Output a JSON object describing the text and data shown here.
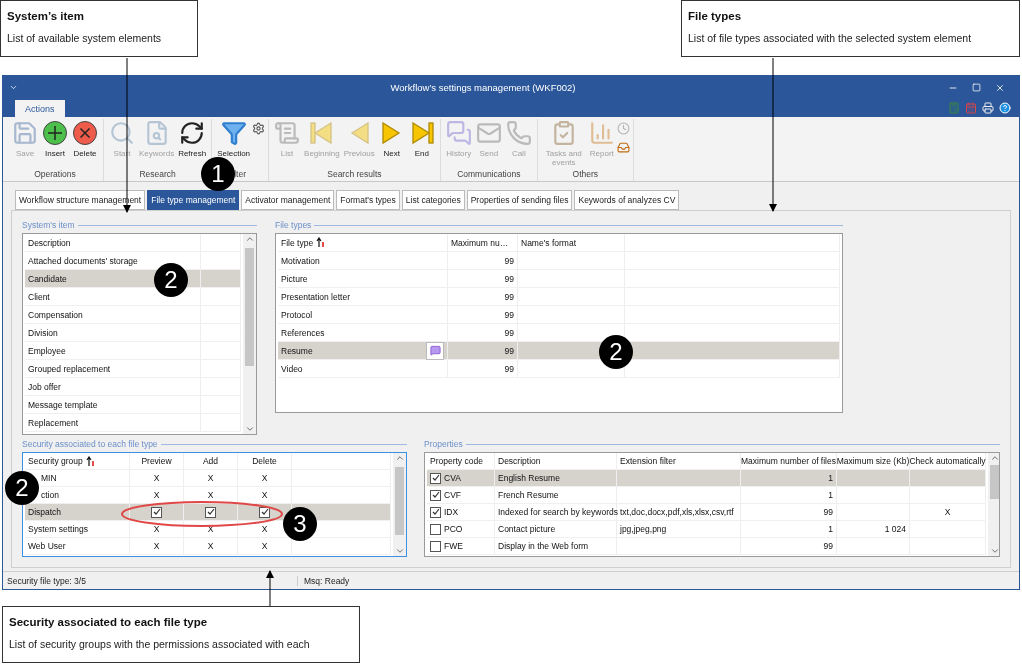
{
  "callouts": [
    {
      "title": "System’s item",
      "text": "List of available system elements"
    },
    {
      "title": "File types",
      "text": "List of file types associated with the selected system element"
    },
    {
      "title": "Security associated to each file type",
      "text": "List of security groups with the permissions associated with each"
    }
  ],
  "markers": [
    "1",
    "2",
    "2",
    "2",
    "3"
  ],
  "window": {
    "title": "Workflow’s settings management (WKF002)"
  },
  "ribbon_tabs": [
    {
      "label": "Actions",
      "selected": true
    }
  ],
  "ribbon_groups": [
    {
      "label": "Operations",
      "buttons": [
        {
          "kind": "save",
          "label": "Save",
          "disabled": true
        },
        {
          "kind": "insert",
          "label": "Insert",
          "disabled": false
        },
        {
          "kind": "delete",
          "label": "Delete",
          "disabled": false
        }
      ]
    },
    {
      "label": "Research",
      "buttons": [
        {
          "kind": "start",
          "label": "Start",
          "disabled": true
        },
        {
          "kind": "keywords",
          "label": "Keywords",
          "disabled": true
        },
        {
          "kind": "refresh",
          "label": "Refresh",
          "disabled": false
        }
      ]
    },
    {
      "label": "lter",
      "buttons": [
        {
          "kind": "selection",
          "label": "Selection",
          "disabled": false
        },
        {
          "kind": "settings",
          "disabled": false
        }
      ]
    },
    {
      "label": "Search results",
      "buttons": [
        {
          "kind": "list",
          "label": "List",
          "disabled": true
        },
        {
          "kind": "beginning",
          "label": "Beginning",
          "disabled": true
        },
        {
          "kind": "previous",
          "label": "Previous",
          "disabled": true
        },
        {
          "kind": "next",
          "label": "Next",
          "disabled": false
        },
        {
          "kind": "end",
          "label": "End",
          "disabled": false
        }
      ]
    },
    {
      "label": "Communications",
      "buttons": [
        {
          "kind": "history",
          "label": "History",
          "disabled": true
        },
        {
          "kind": "send",
          "label": "Send",
          "disabled": true
        },
        {
          "kind": "call",
          "label": "Call",
          "disabled": true
        }
      ]
    },
    {
      "label": "Others",
      "buttons": [
        {
          "kind": "tasks",
          "label": "Tasks and events",
          "disabled": true
        },
        {
          "kind": "report",
          "label": "Report",
          "disabled": true
        },
        {
          "kind": "clock",
          "disabled": true
        },
        {
          "kind": "inbox",
          "disabled": false
        }
      ]
    }
  ],
  "tabs": [
    {
      "label": "Workflow structure management",
      "selected": false
    },
    {
      "label": "File type management",
      "selected": true
    },
    {
      "label": "Activator management",
      "selected": false
    },
    {
      "label": "Format's types",
      "selected": false
    },
    {
      "label": "List categories",
      "selected": false
    },
    {
      "label": "Properties of sending files",
      "selected": false
    },
    {
      "label": "Keywords of analyzes CV",
      "selected": false
    }
  ],
  "system_items": {
    "title": "System's item",
    "columns": [
      "Description"
    ],
    "rows": [
      {
        "label": "Attached documents' storage",
        "selected": false
      },
      {
        "label": "Candidate",
        "selected": true
      },
      {
        "label": "Client",
        "selected": false
      },
      {
        "label": "Compensation",
        "selected": false
      },
      {
        "label": "Division",
        "selected": false
      },
      {
        "label": "Employee",
        "selected": false
      },
      {
        "label": "Grouped replacement",
        "selected": false
      },
      {
        "label": "Job offer",
        "selected": false
      },
      {
        "label": "Message template",
        "selected": false
      },
      {
        "label": "Replacement",
        "selected": false
      }
    ]
  },
  "file_types": {
    "title": "File types",
    "columns": [
      "File type",
      "Maximum nu…",
      "Name's format"
    ],
    "rows": [
      {
        "type": "Motivation",
        "max": "99",
        "note": false,
        "selected": false
      },
      {
        "type": "Picture",
        "max": "99",
        "note": false,
        "selected": false
      },
      {
        "type": "Presentation letter",
        "max": "99",
        "note": false,
        "selected": false
      },
      {
        "type": "Protocol",
        "max": "99",
        "note": false,
        "selected": false
      },
      {
        "type": "References",
        "max": "99",
        "note": false,
        "selected": false
      },
      {
        "type": "Resume",
        "max": "99",
        "note": true,
        "selected": true
      },
      {
        "type": "Video",
        "max": "99",
        "note": false,
        "selected": false
      }
    ]
  },
  "security": {
    "title": "Security associated to each file type",
    "columns": [
      "Security group",
      "Preview",
      "Add",
      "Delete"
    ],
    "rows": [
      {
        "group": "MIN",
        "selected": false,
        "permissions": [
          {
            "kind": "text",
            "text": "X"
          },
          {
            "kind": "text",
            "text": "X"
          },
          {
            "kind": "text",
            "text": "X"
          }
        ]
      },
      {
        "group": "ction",
        "selected": false,
        "permissions": [
          {
            "kind": "text",
            "text": "X"
          },
          {
            "kind": "text",
            "text": "X"
          },
          {
            "kind": "text",
            "text": "X"
          }
        ]
      },
      {
        "group": "Dispatch",
        "selected": true,
        "permissions": [
          {
            "kind": "checkbox",
            "checked": true
          },
          {
            "kind": "checkbox",
            "checked": true
          },
          {
            "kind": "checkbox",
            "checked": true
          }
        ]
      },
      {
        "group": "System settings",
        "selected": false,
        "permissions": [
          {
            "kind": "text",
            "text": "X"
          },
          {
            "kind": "text",
            "text": "X"
          },
          {
            "kind": "text",
            "text": "X"
          }
        ]
      },
      {
        "group": "Web User",
        "selected": false,
        "permissions": [
          {
            "kind": "text",
            "text": "X"
          },
          {
            "kind": "text",
            "text": "X"
          },
          {
            "kind": "text",
            "text": "X"
          }
        ]
      }
    ]
  },
  "properties": {
    "title": "Properties",
    "columns": [
      "Property code",
      "Description",
      "Extension filter",
      "Maximum number of files",
      "Maximum size (Kb)",
      "Check automatically"
    ],
    "rows": [
      {
        "checked": true,
        "code": "CVA",
        "description": "English Resume",
        "max_files": "1",
        "selected": true
      },
      {
        "checked": true,
        "code": "CVF",
        "description": "French Resume",
        "max_files": "1",
        "selected": false
      },
      {
        "checked": true,
        "code": "IDX",
        "description": "Indexed for search by keywords",
        "extension_filter": "txt,doc,docx,pdf,xls,xlsx,csv,rtf",
        "max_files": "99",
        "check_auto": "X",
        "selected": false
      },
      {
        "checked": false,
        "code": "PCO",
        "description": "Contact picture",
        "extension_filter": "jpg,jpeg,png",
        "max_files": "1",
        "max_size": "1 024",
        "selected": false
      },
      {
        "checked": false,
        "code": "FWE",
        "description": "Display in the Web form",
        "max_files": "99",
        "selected": false
      }
    ]
  },
  "status_bar": {
    "left": "Security file type: 3/5",
    "right": "Msq: Ready"
  }
}
